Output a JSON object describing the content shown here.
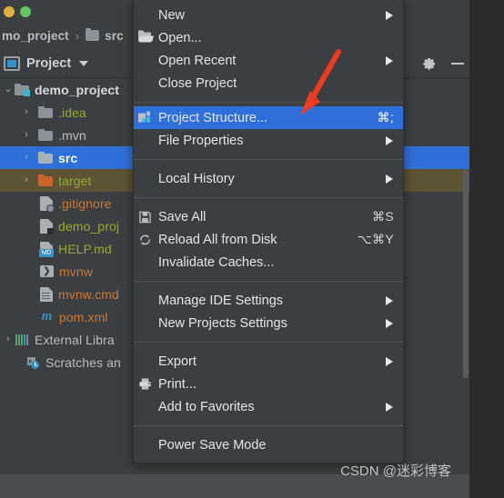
{
  "window": {
    "traffic_lights": [
      "minimize-yellow",
      "maximize-green"
    ],
    "breadcrumb": {
      "project_fragment": "mo_project",
      "separator": "›",
      "folder": "src"
    }
  },
  "tool_window": {
    "title": "Project",
    "caret_icon": "chevron-down-icon",
    "actions": [
      {
        "name": "gear-icon",
        "label": "Settings"
      },
      {
        "name": "minimize-icon",
        "label": "Hide"
      }
    ]
  },
  "tree": {
    "rows": [
      {
        "label": "demo_project",
        "arrow": "⌄",
        "icon": "project-folder-icon",
        "color": "#d6d9db",
        "bold": true,
        "state": "expanded",
        "indent": 2
      },
      {
        "label": ".idea",
        "arrow": "›",
        "icon": "folder-icon",
        "color": "#9aa82f",
        "bold": false,
        "state": "collapsed",
        "indent": 22
      },
      {
        "label": ".mvn",
        "arrow": "›",
        "icon": "folder-icon",
        "color": "#b9bec2",
        "bold": false,
        "state": "collapsed",
        "indent": 22
      },
      {
        "label": "src",
        "arrow": "›",
        "icon": "folder-icon-light",
        "color": "#ffffff",
        "bold": true,
        "state": "selected",
        "indent": 22
      },
      {
        "label": "target",
        "arrow": "›",
        "icon": "folder-icon-orange",
        "color": "#9aa82f",
        "bold": false,
        "state": "olive",
        "indent": 22
      },
      {
        "label": ".gitignore",
        "arrow": "",
        "icon": "gitignore-file-icon",
        "color": "#cc7832",
        "bold": false,
        "state": "",
        "indent": 44
      },
      {
        "label": "demo_proj",
        "arrow": "",
        "icon": "iml-file-icon",
        "color": "#9aa82f",
        "bold": false,
        "state": "",
        "indent": 44
      },
      {
        "label": "HELP.md",
        "arrow": "",
        "icon": "markdown-file-icon",
        "color": "#9aa82f",
        "bold": false,
        "state": "",
        "indent": 44
      },
      {
        "label": "mvnw",
        "arrow": "",
        "icon": "shell-script-icon",
        "color": "#cc7832",
        "bold": false,
        "state": "",
        "indent": 44
      },
      {
        "label": "mvnw.cmd",
        "arrow": "",
        "icon": "cmd-file-icon",
        "color": "#cc7832",
        "bold": false,
        "state": "",
        "indent": 44
      },
      {
        "label": "pom.xml",
        "arrow": "",
        "icon": "maven-file-icon",
        "color": "#cc7832",
        "bold": false,
        "state": "",
        "indent": 44
      },
      {
        "label": "External Libra",
        "arrow": "›",
        "icon": "libraries-icon",
        "color": "#b9bec2",
        "bold": false,
        "state": "collapsed",
        "indent": 2
      },
      {
        "label": "Scratches an",
        "arrow": "",
        "icon": "scratches-icon",
        "color": "#b9bec2",
        "bold": false,
        "state": "",
        "indent": 22
      }
    ],
    "md_badge": "MD",
    "shell_glyph": "❯",
    "maven_glyph": "m"
  },
  "menu": {
    "groups": [
      {
        "items": [
          {
            "label": "New",
            "shortcut": "",
            "icon": "",
            "submenu": true,
            "highlight": false
          },
          {
            "label": "Open...",
            "shortcut": "",
            "icon": "open-folder-icon",
            "submenu": false,
            "highlight": false
          },
          {
            "label": "Open Recent",
            "shortcut": "",
            "icon": "",
            "submenu": true,
            "highlight": false
          },
          {
            "label": "Close Project",
            "shortcut": "",
            "icon": "",
            "submenu": false,
            "highlight": false
          }
        ]
      },
      {
        "items": [
          {
            "label": "Project Structure...",
            "shortcut": "⌘;",
            "icon": "project-structure-icon",
            "submenu": false,
            "highlight": true
          },
          {
            "label": "File Properties",
            "shortcut": "",
            "icon": "",
            "submenu": true,
            "highlight": false
          }
        ]
      },
      {
        "items": [
          {
            "label": "Local History",
            "shortcut": "",
            "icon": "",
            "submenu": true,
            "highlight": false
          }
        ]
      },
      {
        "items": [
          {
            "label": "Save All",
            "shortcut": "⌘S",
            "icon": "save-icon",
            "submenu": false,
            "highlight": false
          },
          {
            "label": "Reload All from Disk",
            "shortcut": "⌥⌘Y",
            "icon": "reload-icon",
            "submenu": false,
            "highlight": false
          },
          {
            "label": "Invalidate Caches...",
            "shortcut": "",
            "icon": "",
            "submenu": false,
            "highlight": false
          }
        ]
      },
      {
        "items": [
          {
            "label": "Manage IDE Settings",
            "shortcut": "",
            "icon": "",
            "submenu": true,
            "highlight": false
          },
          {
            "label": "New Projects Settings",
            "shortcut": "",
            "icon": "",
            "submenu": true,
            "highlight": false
          }
        ]
      },
      {
        "items": [
          {
            "label": "Export",
            "shortcut": "",
            "icon": "",
            "submenu": true,
            "highlight": false
          },
          {
            "label": "Print...",
            "shortcut": "",
            "icon": "printer-icon",
            "submenu": false,
            "highlight": false
          },
          {
            "label": "Add to Favorites",
            "shortcut": "",
            "icon": "",
            "submenu": true,
            "highlight": false
          }
        ]
      },
      {
        "items": [
          {
            "label": "Power Save Mode",
            "shortcut": "",
            "icon": "",
            "submenu": false,
            "highlight": false
          }
        ]
      }
    ]
  },
  "annotation": {
    "arrow_color": "#f03b20",
    "points_to": "Project Structure..."
  },
  "watermark": {
    "text": "CSDN @迷彩博客"
  },
  "colors": {
    "menu_bg": "#3c3f41",
    "highlight_blue": "#2f6fd9",
    "selection_olive": "#5c5434",
    "text": "#e3e5e7",
    "folder_orange": "#cc6327",
    "accent_cyan": "#45c0d8"
  }
}
